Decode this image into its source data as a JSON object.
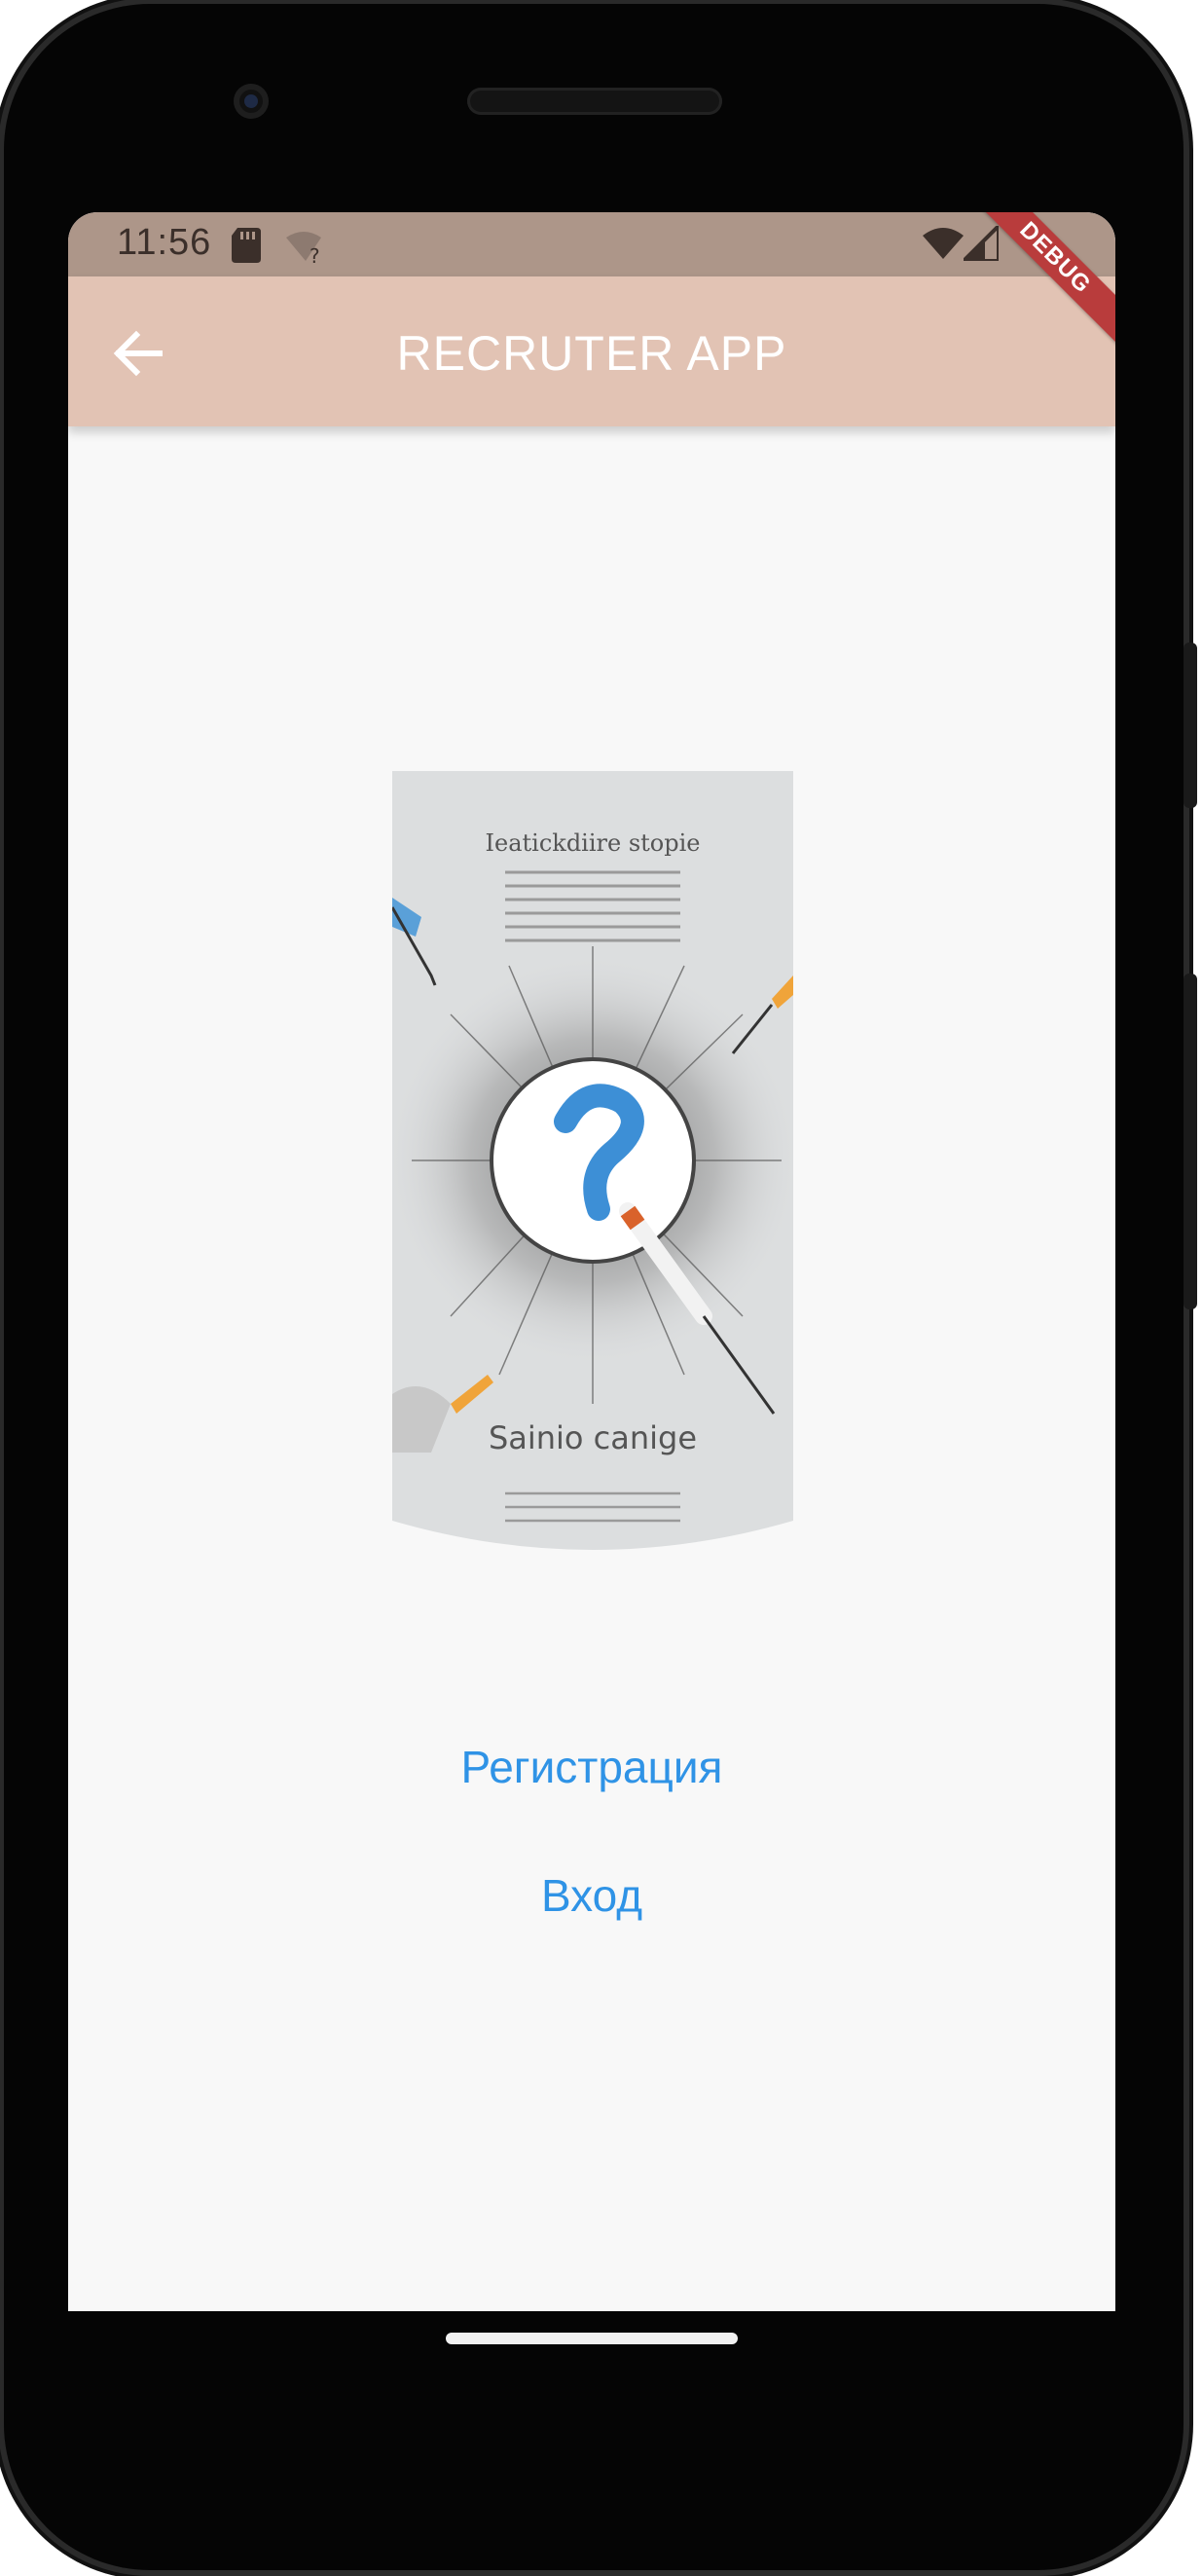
{
  "status_bar": {
    "time": "11:56",
    "icons": [
      "sd-card-icon",
      "wifi-unknown-icon",
      "wifi-icon",
      "signal-icon"
    ]
  },
  "app_bar": {
    "title": "RECRUTER APP",
    "back_icon": "arrow-back-icon",
    "background": "#e2c3b4"
  },
  "debug_banner": "DEBUG",
  "hero": {
    "image": "question-mark-illustration",
    "poster_title": "Ieatickdiire stopie",
    "poster_caption": "Sainio canige"
  },
  "actions": {
    "register_label": "Регистрация",
    "login_label": "Вход",
    "color": "#2f93e6"
  }
}
